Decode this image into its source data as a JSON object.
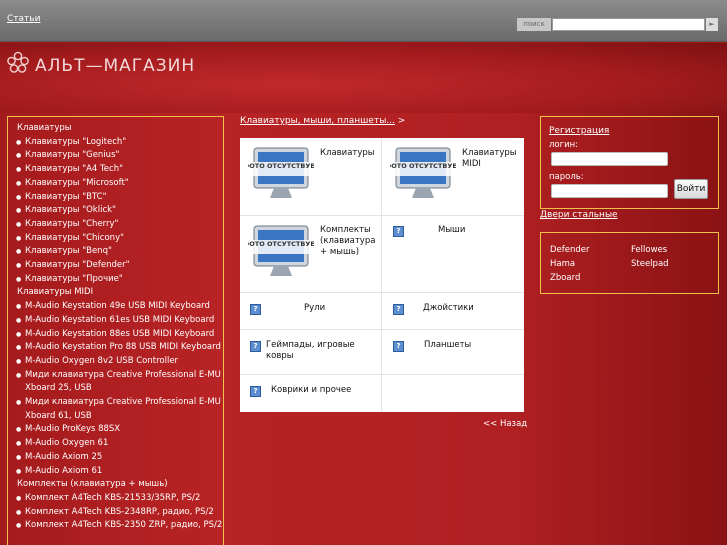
{
  "topbar": {
    "articles_link": "Статьи",
    "search_button": "поиск",
    "search_value": "",
    "go_icon": "arrow-right-icon"
  },
  "header": {
    "logo_text": "АЛЬТ—МАГАЗИН"
  },
  "sidebar": {
    "items": [
      {
        "type": "cat",
        "label": "Клавиатуры"
      },
      {
        "type": "item",
        "label": "Клавиатуры \"Logitech\""
      },
      {
        "type": "item",
        "label": "Клавиатуры \"Genius\""
      },
      {
        "type": "item",
        "label": "Клавиатуры \"A4 Tech\""
      },
      {
        "type": "item",
        "label": "Клавиатуры \"Microsoft\""
      },
      {
        "type": "item",
        "label": "Клавиатуры \"BTC\""
      },
      {
        "type": "item",
        "label": "Клавиатуры \"Oklick\""
      },
      {
        "type": "item",
        "label": "Клавиатуры \"Cherry\""
      },
      {
        "type": "item",
        "label": "Клавиатуры \"Chicony\""
      },
      {
        "type": "item",
        "label": "Клавиатуры \"Benq\""
      },
      {
        "type": "item",
        "label": "Клавиатуры \"Defender\""
      },
      {
        "type": "item",
        "label": "Клавиатуры \"Прочие\""
      },
      {
        "type": "cat",
        "label": "Клавиатуры MIDI"
      },
      {
        "type": "item",
        "label": "M-Audio Keystation 49e USB MIDI Keyboard"
      },
      {
        "type": "item",
        "label": "M-Audio Keystation 61es USB MIDI Keyboard"
      },
      {
        "type": "item",
        "label": "M-Audio Keystation 88es USB MIDI Keyboard"
      },
      {
        "type": "item",
        "label": "M-Audio Keystation Pro 88 USB MIDI Keyboard"
      },
      {
        "type": "item",
        "label": "M-Audio Oxygen 8v2 USB Controller"
      },
      {
        "type": "item",
        "label": "Миди клавиатура Creative Professional E-MU Xboard 25, USB"
      },
      {
        "type": "item",
        "label": "Миди клавиатура Creative Professional E-MU Xboard 61, USB"
      },
      {
        "type": "item",
        "label": "M-Audio ProKeys 88SX"
      },
      {
        "type": "item",
        "label": "M-Audio Oxygen 61"
      },
      {
        "type": "item",
        "label": "M-Audio Axiom 25"
      },
      {
        "type": "item",
        "label": "M-Audio Axiom 61"
      },
      {
        "type": "cat",
        "label": "Комплекты (клавиатура + мышь)"
      },
      {
        "type": "item",
        "label": "Комплект A4Tech KBS-21533/35RP, PS/2"
      },
      {
        "type": "item",
        "label": "Комплект A4Tech KBS-2348RP, радио, PS/2"
      },
      {
        "type": "item",
        "label": "Комплект A4Tech KBS-2350 ZRP, радио, PS/2"
      }
    ]
  },
  "breadcrumb": {
    "link": "Клавиатуры, мыши, планшеты...",
    "sep": " >"
  },
  "photo_text": "ФОТО ОТСУТСТВУЕТ",
  "categories": [
    "Клавиатуры",
    "Клавиатуры MIDI",
    "Комплекты (клавиатура + мышь)",
    "Мыши",
    "Рули",
    "Джойстики",
    "Геймпады, игровые ковры",
    "Планшеты",
    "Коврики и прочее"
  ],
  "back_link": "<< Назад",
  "registration": {
    "title": "Регистрация",
    "login_label": "логин:",
    "password_label": "пароль:",
    "login_button": "Войти"
  },
  "doors_link": "Двери стальные",
  "brands": [
    "Defender",
    "Fellowes",
    "Hama",
    "Steelpad",
    "Zboard"
  ]
}
